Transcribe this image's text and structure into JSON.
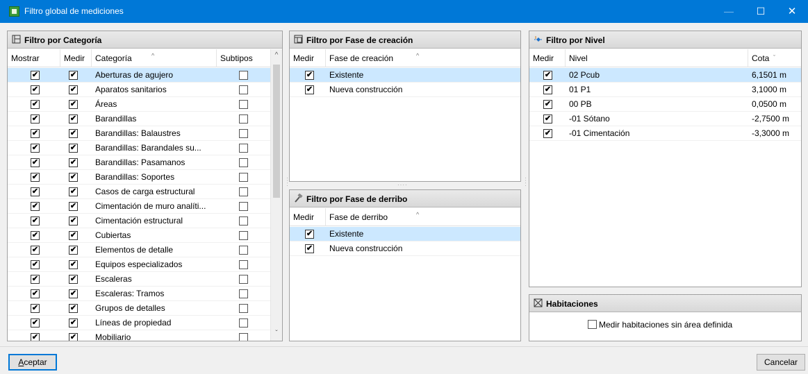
{
  "window": {
    "title": "Filtro global de mediciones",
    "minimize": "—",
    "maximize": "☐",
    "close": "✕"
  },
  "categories": {
    "title": "Filtro por Categoría",
    "headers": {
      "show": "Mostrar",
      "measure": "Medir",
      "category": "Categoría",
      "subtypes": "Subtipos"
    },
    "rows": [
      {
        "name": "Aberturas de agujero",
        "show": true,
        "measure": true,
        "subtypes": false
      },
      {
        "name": "Aparatos sanitarios",
        "show": true,
        "measure": true,
        "subtypes": false
      },
      {
        "name": "Áreas",
        "show": true,
        "measure": true,
        "subtypes": false
      },
      {
        "name": "Barandillas",
        "show": true,
        "measure": true,
        "subtypes": false
      },
      {
        "name": "Barandillas: Balaustres",
        "show": true,
        "measure": true,
        "subtypes": false
      },
      {
        "name": "Barandillas: Barandales su...",
        "show": true,
        "measure": true,
        "subtypes": false
      },
      {
        "name": "Barandillas: Pasamanos",
        "show": true,
        "measure": true,
        "subtypes": false
      },
      {
        "name": "Barandillas: Soportes",
        "show": true,
        "measure": true,
        "subtypes": false
      },
      {
        "name": "Casos de carga estructural",
        "show": true,
        "measure": true,
        "subtypes": false
      },
      {
        "name": "Cimentación de muro analíti...",
        "show": true,
        "measure": true,
        "subtypes": false
      },
      {
        "name": "Cimentación estructural",
        "show": true,
        "measure": true,
        "subtypes": false
      },
      {
        "name": "Cubiertas",
        "show": true,
        "measure": true,
        "subtypes": false
      },
      {
        "name": "Elementos de detalle",
        "show": true,
        "measure": true,
        "subtypes": false
      },
      {
        "name": "Equipos especializados",
        "show": true,
        "measure": true,
        "subtypes": false
      },
      {
        "name": "Escaleras",
        "show": true,
        "measure": true,
        "subtypes": false
      },
      {
        "name": "Escaleras: Tramos",
        "show": true,
        "measure": true,
        "subtypes": false
      },
      {
        "name": "Grupos de detalles",
        "show": true,
        "measure": true,
        "subtypes": false
      },
      {
        "name": "Líneas de propiedad",
        "show": true,
        "measure": true,
        "subtypes": false
      },
      {
        "name": "Mobiliario",
        "show": true,
        "measure": true,
        "subtypes": false
      }
    ]
  },
  "creation": {
    "title": "Filtro por Fase de creación",
    "headers": {
      "measure": "Medir",
      "phase": "Fase de creación"
    },
    "rows": [
      {
        "name": "Existente",
        "measure": true
      },
      {
        "name": "Nueva construcción",
        "measure": true
      }
    ]
  },
  "demolition": {
    "title": "Filtro por Fase de derribo",
    "headers": {
      "measure": "Medir",
      "phase": "Fase de derribo"
    },
    "rows": [
      {
        "name": "Existente",
        "measure": true
      },
      {
        "name": "Nueva construcción",
        "measure": true
      }
    ]
  },
  "levels": {
    "title": "Filtro por Nivel",
    "headers": {
      "measure": "Medir",
      "level": "Nivel",
      "elevation": "Cota"
    },
    "rows": [
      {
        "name": "02 Pcub",
        "elevation": "6,1501 m",
        "measure": true
      },
      {
        "name": "01 P1",
        "elevation": "3,1000 m",
        "measure": true
      },
      {
        "name": "00 PB",
        "elevation": "0,0500 m",
        "measure": true
      },
      {
        "name": "-01 Sótano",
        "elevation": "-2,7500 m",
        "measure": true
      },
      {
        "name": "-01 Cimentación",
        "elevation": "-3,3000 m",
        "measure": true
      }
    ]
  },
  "rooms": {
    "title": "Habitaciones",
    "checkbox_label": "Medir habitaciones sin área definida",
    "checked": false
  },
  "footer": {
    "accept_mnemonic": "A",
    "accept_rest": "ceptar",
    "cancel": "Cancelar"
  },
  "glyphs": {
    "check": "✔",
    "sort_up": "^",
    "sort_down": "ˇ",
    "scroll_up": "^",
    "scroll_down": "ˇ"
  }
}
